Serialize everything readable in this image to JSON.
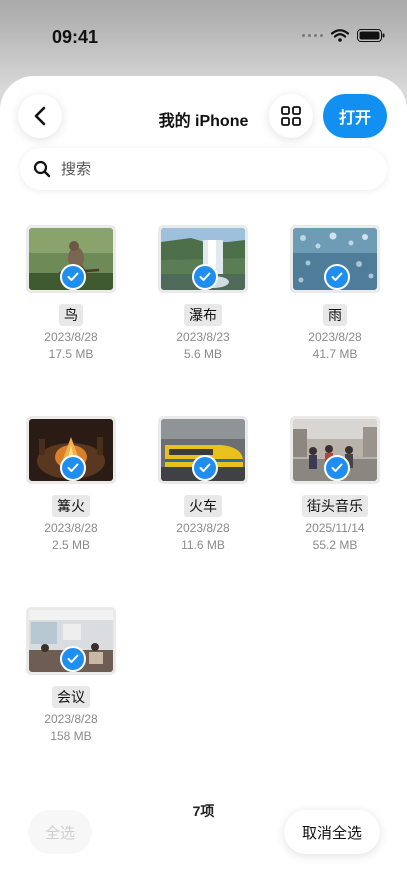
{
  "status_bar": {
    "time": "09:41"
  },
  "header": {
    "title": "我的 iPhone",
    "open_label": "打开"
  },
  "search": {
    "placeholder": "搜索"
  },
  "files": [
    {
      "name": "鸟",
      "date": "2023/8/28",
      "size": "17.5 MB",
      "thumb": "bird"
    },
    {
      "name": "瀑布",
      "date": "2023/8/23",
      "size": "5.6 MB",
      "thumb": "waterfall"
    },
    {
      "name": "雨",
      "date": "2023/8/28",
      "size": "41.7 MB",
      "thumb": "rain"
    },
    {
      "name": "篝火",
      "date": "2023/8/28",
      "size": "2.5 MB",
      "thumb": "campfire"
    },
    {
      "name": "火车",
      "date": "2023/8/28",
      "size": "11.6 MB",
      "thumb": "train"
    },
    {
      "name": "街头音乐",
      "date": "2025/11/14",
      "size": "55.2 MB",
      "thumb": "street-music"
    },
    {
      "name": "会议",
      "date": "2023/8/28",
      "size": "158 MB",
      "thumb": "meeting"
    }
  ],
  "footer": {
    "count": "7项",
    "select_all": "全选",
    "deselect_all": "取消全选"
  },
  "colors": {
    "accent": "#1190f2",
    "check": "#1e8ef0"
  }
}
